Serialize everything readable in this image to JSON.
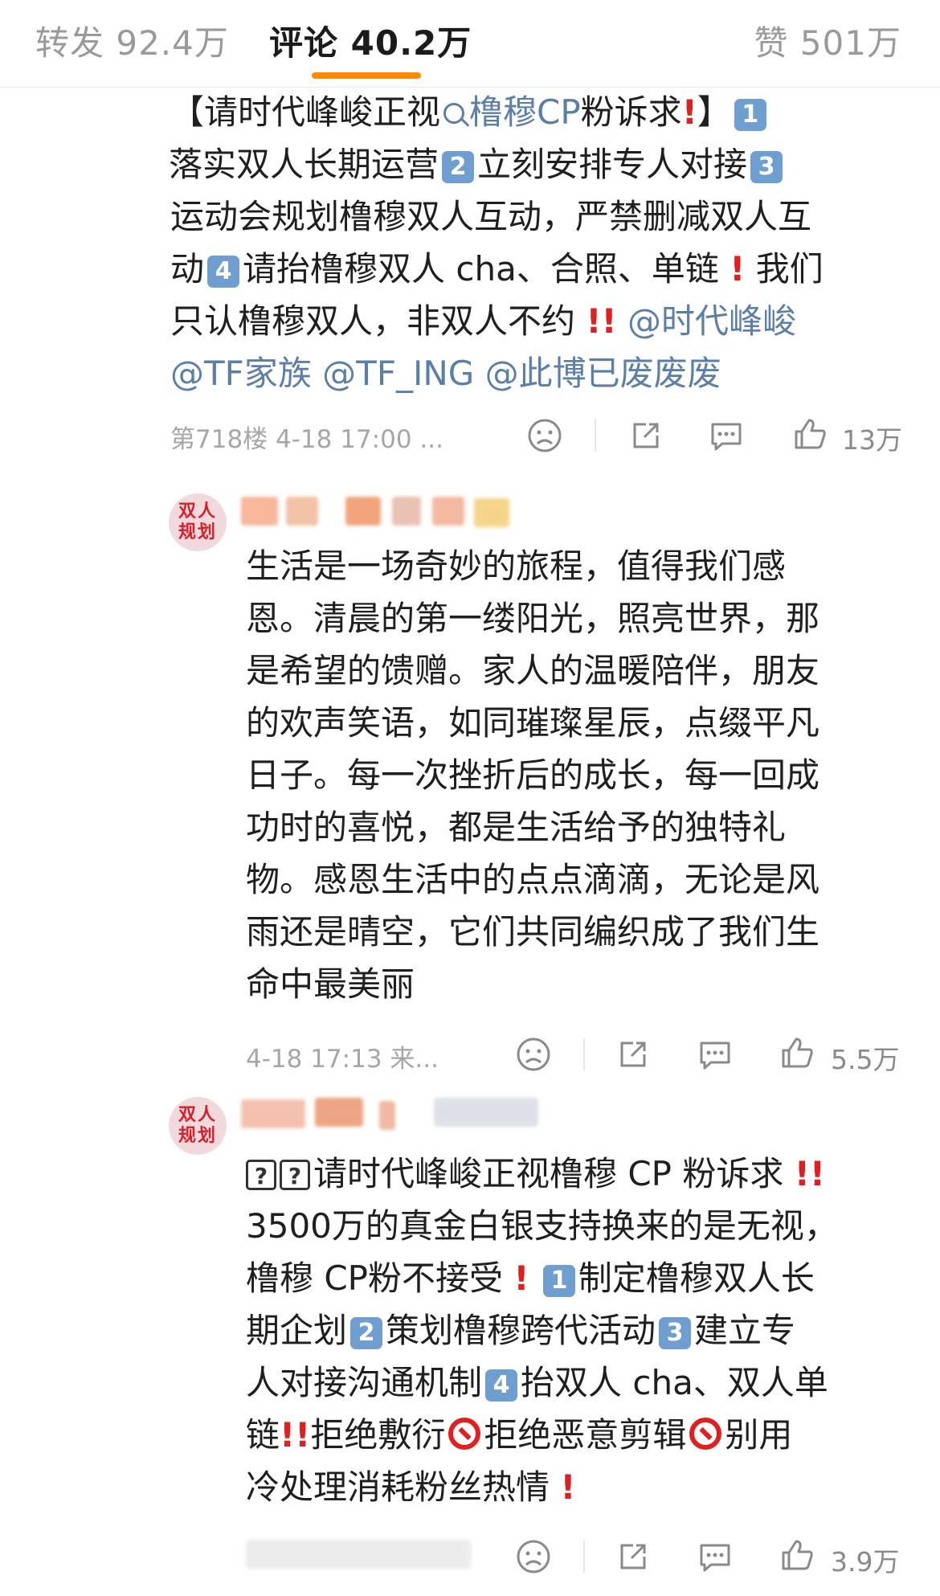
{
  "tabs": {
    "repost": "转发 92.4万",
    "comments": "评论 40.2万",
    "likes": "赞 501万",
    "accent_color": "#ff8a00"
  },
  "comment1": {
    "l1_a": "【请时代峰峻正视",
    "l1_link": "橹穆CP",
    "l1_b": "粉诉求",
    "l1_c": "】",
    "b1": "1",
    "l2_a": "落实双人长期运营",
    "b2": "2",
    "l2_b": "立刻安排专人对接",
    "b3": "3",
    "l3": "运动会规划橹穆双人互动，严禁删减双人互",
    "l4_a": "动",
    "b4": "4",
    "l4_b": "请抬橹穆双人 cha、合照、单链",
    "l4_c": "我们",
    "l5_a": "只认橹穆双人，非双人不约",
    "l5_link": "@时代峰峻",
    "l6": "@TF家族 @TF_ING @此博已废废废",
    "floor": "第718楼 4-18 17:00 ...",
    "like_count": "13万"
  },
  "reply1": {
    "avatar_text_1": "双人",
    "avatar_text_2": "规划",
    "lines": [
      "生活是一场奇妙的旅程，值得我们感",
      "恩。清晨的第一缕阳光，照亮世界，那",
      "是希望的馈赠。家人的温暖陪伴，朋友",
      "的欢声笑语，如同璀璨星辰，点缀平凡",
      "日子。每一次挫折后的成长，每一回成",
      "功时的喜悦，都是生活给予的独特礼",
      "物。感恩生活中的点点滴滴，无论是风",
      "雨还是晴空，它们共同编织成了我们生",
      "命中最美丽"
    ],
    "meta": "4-18 17:13 来...",
    "like_count": "5.5万"
  },
  "reply2": {
    "avatar_text_1": "双人",
    "avatar_text_2": "规划",
    "q": "?",
    "l1": "请时代峰峻正视橹穆 CP 粉诉求",
    "l2": "3500万的真金白银支持换来的是无视，",
    "l3_a": "橹穆 CP粉不接受",
    "b1": "1",
    "l3_b": "制定橹穆双人长",
    "l4_a": "期企划",
    "b2": "2",
    "l4_b": "策划橹穆跨代活动",
    "b3": "3",
    "l4_c": "建立专",
    "l5_a": "人对接沟通机制",
    "b4": "4",
    "l5_b": "抬双人 cha、双人单",
    "l6_a": "链",
    "l6_b": "拒绝敷衍",
    "l6_c": "拒绝恶意剪辑",
    "l6_d": "别用",
    "l7": "冷处理消耗粉丝热情",
    "like_count": "3.9万"
  },
  "icons": {
    "dislike": "frown-face-icon",
    "share": "share-icon",
    "comment": "comment-bubble-icon",
    "like": "thumbs-up-icon"
  }
}
